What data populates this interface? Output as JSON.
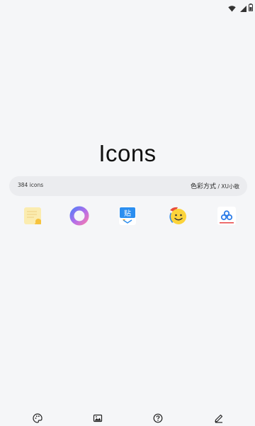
{
  "status_bar": {
    "icons": [
      "wifi-icon",
      "battery-icon"
    ]
  },
  "hero": {
    "title": "Icons"
  },
  "info_bar": {
    "count_text": "384 icons",
    "style_main": "色彩方式",
    "separator": " / ",
    "style_author": "XU小敬"
  },
  "icon_row": {
    "icons": [
      "notes-icon",
      "ring-icon",
      "sticker-app-icon",
      "smiley-face-icon",
      "cloud-app-icon"
    ]
  },
  "bottom_nav": {
    "items": [
      "palette-icon",
      "image-icon",
      "help-icon",
      "edit-icon"
    ]
  },
  "colors": {
    "background": "#f5f6f8",
    "info_bar_bg": "#ebecef",
    "text_primary": "#111111"
  }
}
